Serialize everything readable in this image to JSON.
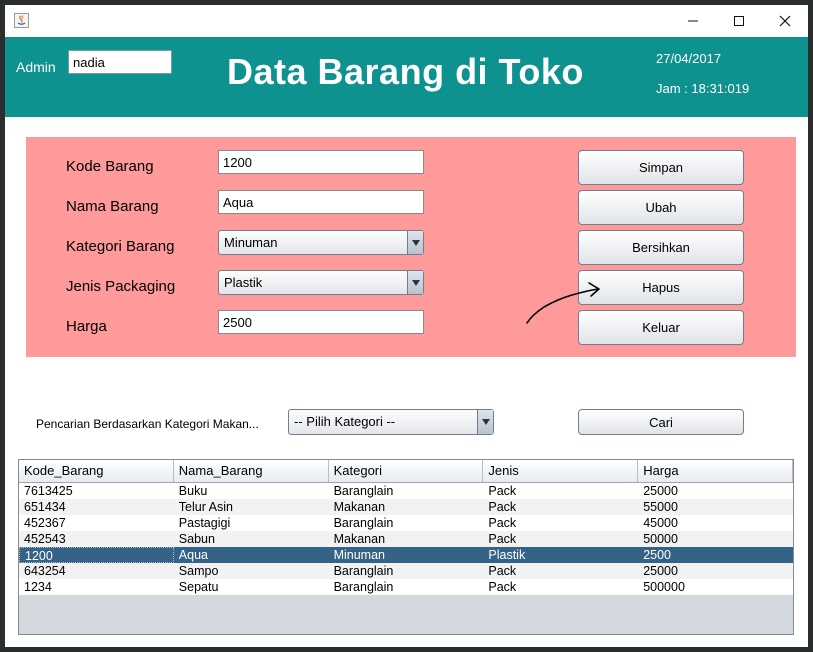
{
  "window": {
    "minimize_glyph": "—",
    "maximize_glyph": "☐",
    "close_glyph": "✕"
  },
  "header": {
    "admin_label": "Admin",
    "admin_value": "nadia",
    "title": "Data Barang di Toko",
    "date": "27/04/2017",
    "time": "Jam : 18:31:019",
    "background_color": "#0e9290"
  },
  "form": {
    "background_color": "#ff9a9a",
    "fields": {
      "kode": {
        "label": "Kode Barang",
        "value": "1200"
      },
      "nama": {
        "label": "Nama Barang",
        "value": "Aqua"
      },
      "kategori": {
        "label": "Kategori Barang",
        "value": "Minuman"
      },
      "jenis": {
        "label": "Jenis Packaging",
        "value": "Plastik"
      },
      "harga": {
        "label": "Harga",
        "value": "2500"
      }
    },
    "buttons": {
      "simpan": "Simpan",
      "ubah": "Ubah",
      "bersihkan": "Bersihkan",
      "hapus": "Hapus",
      "keluar": "Keluar"
    }
  },
  "search": {
    "label": "Pencarian Berdasarkan Kategori Makan...",
    "combo_value": "-- Pilih Kategori --",
    "button": "Cari"
  },
  "table": {
    "columns": [
      "Kode_Barang",
      "Nama_Barang",
      "Kategori",
      "Jenis",
      "Harga"
    ],
    "rows": [
      [
        "7613425",
        "Buku",
        "Baranglain",
        "Pack",
        "25000"
      ],
      [
        "651434",
        "Telur Asin",
        "Makanan",
        "Pack",
        "55000"
      ],
      [
        "452367",
        "Pastagigi",
        "Baranglain",
        "Pack",
        "45000"
      ],
      [
        "452543",
        "Sabun",
        "Makanan",
        "Pack",
        "50000"
      ],
      [
        "1200",
        "Aqua",
        "Minuman",
        "Plastik",
        "2500"
      ],
      [
        "643254",
        "Sampo",
        "Baranglain",
        "Pack",
        "25000"
      ],
      [
        "1234",
        "Sepatu",
        "Baranglain",
        "Pack",
        "500000"
      ]
    ],
    "selected_row": 4,
    "selected_color": "#356287"
  }
}
